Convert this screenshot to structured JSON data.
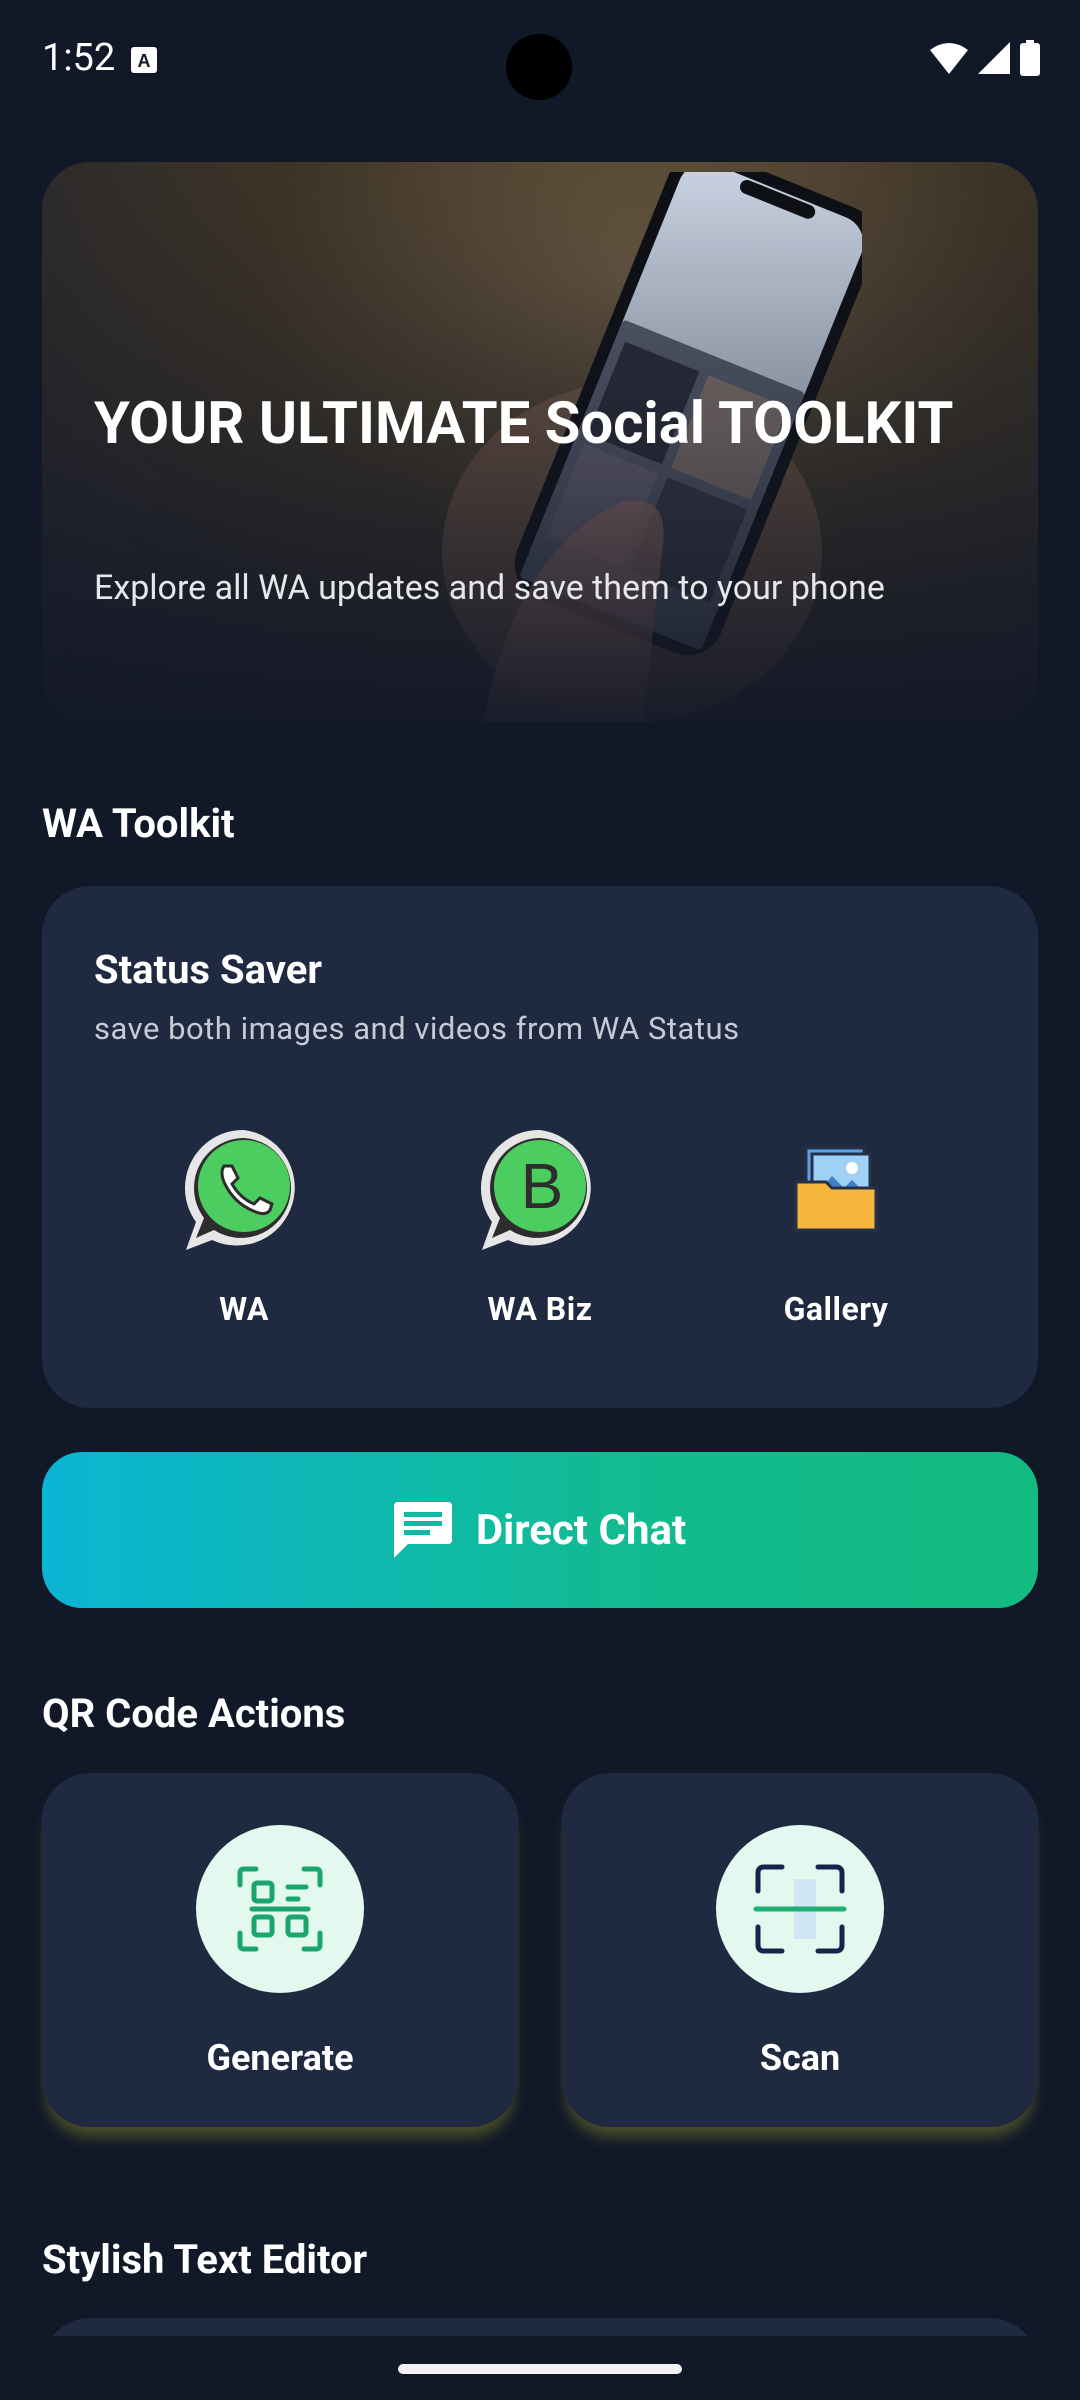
{
  "status_bar": {
    "time": "1:52"
  },
  "hero": {
    "title": "YOUR ULTIMATE Social TOOLKIT",
    "subtitle": "Explore all WA updates and save them to your phone"
  },
  "sections": {
    "wa_toolkit": "WA Toolkit",
    "qr_actions": "QR Code Actions",
    "stylish_text": "Stylish Text Editor"
  },
  "status_saver": {
    "title": "Status Saver",
    "subtitle": "save both images and videos from WA Status",
    "apps": [
      {
        "label": "WA",
        "icon": "whatsapp-icon"
      },
      {
        "label": "WA Biz",
        "icon": "whatsapp-business-icon"
      },
      {
        "label": "Gallery",
        "icon": "gallery-folder-icon"
      }
    ]
  },
  "direct_chat": {
    "label": "Direct Chat",
    "icon": "chat-bubble-icon"
  },
  "qr": {
    "generate_label": "Generate",
    "scan_label": "Scan"
  },
  "colors": {
    "background": "#111828",
    "card": "#1f2a40",
    "gradient_start": "#0bb5d4",
    "gradient_end": "#12bb80"
  }
}
